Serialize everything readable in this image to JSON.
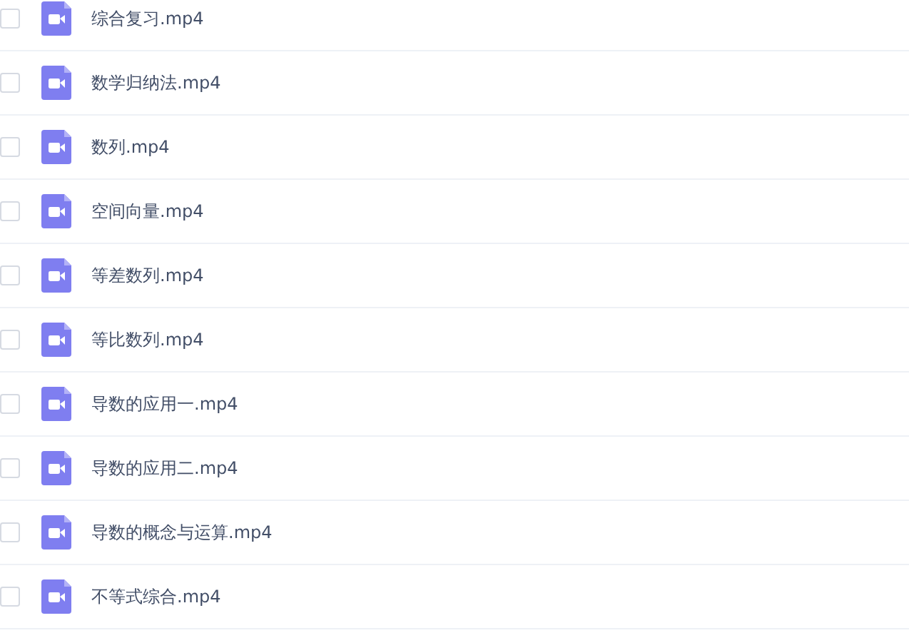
{
  "files": [
    {
      "name": "综合复习.mp4",
      "checked": false
    },
    {
      "name": "数学归纳法.mp4",
      "checked": false
    },
    {
      "name": "数列.mp4",
      "checked": false
    },
    {
      "name": "空间向量.mp4",
      "checked": false
    },
    {
      "name": "等差数列.mp4",
      "checked": false
    },
    {
      "name": "等比数列.mp4",
      "checked": false
    },
    {
      "name": "导数的应用一.mp4",
      "checked": false
    },
    {
      "name": "导数的应用二.mp4",
      "checked": false
    },
    {
      "name": "导数的概念与运算.mp4",
      "checked": false
    },
    {
      "name": "不等式综合.mp4",
      "checked": false
    }
  ]
}
